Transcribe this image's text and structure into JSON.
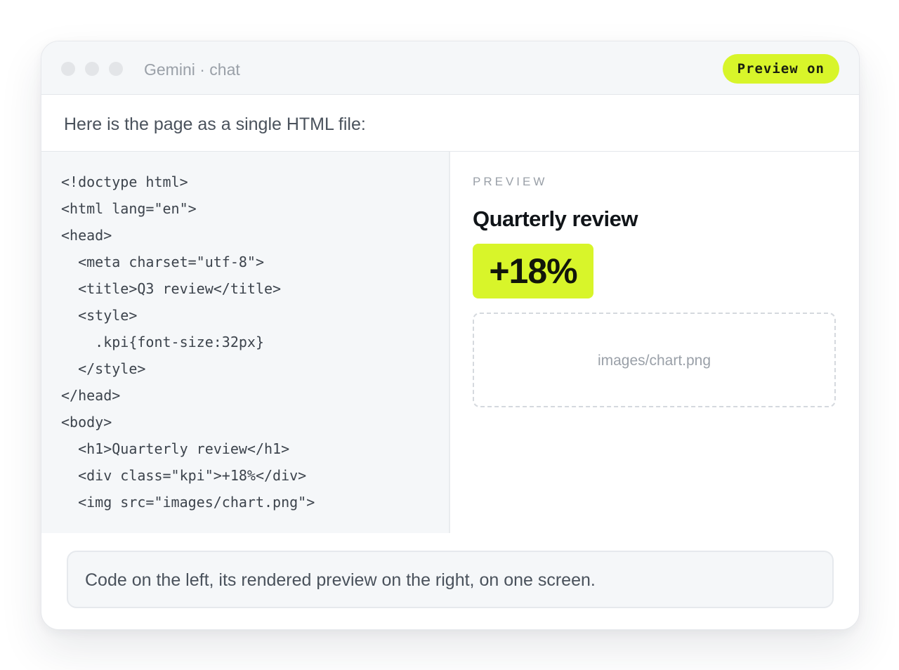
{
  "window": {
    "title": "Gemini · chat",
    "preview_toggle_label": "Preview on"
  },
  "message": {
    "text": "Here is the page as a single HTML file:"
  },
  "code": {
    "lines": [
      "<!doctype html>",
      "<html lang=\"en\">",
      "<head>",
      "  <meta charset=\"utf-8\">",
      "  <title>Q3 review</title>",
      "  <style>",
      "    .kpi{font-size:32px}",
      "  </style>",
      "</head>",
      "<body>",
      "  <h1>Quarterly review</h1>",
      "  <div class=\"kpi\">+18%</div>",
      "  <img src=\"images/chart.png\">"
    ]
  },
  "preview": {
    "label": "PREVIEW",
    "heading": "Quarterly review",
    "kpi": "+18%",
    "image_placeholder": "images/chart.png"
  },
  "caption": {
    "text": "Code on the left, its rendered preview on the right, on one screen."
  },
  "colors": {
    "accent": "#d8f52a",
    "pane_background": "#f5f7f9",
    "text_dark": "#101418",
    "text_muted": "#9aa0a8"
  },
  "icons": {
    "window_controls": [
      "window-dot-icon",
      "window-dot-icon",
      "window-dot-icon"
    ]
  }
}
